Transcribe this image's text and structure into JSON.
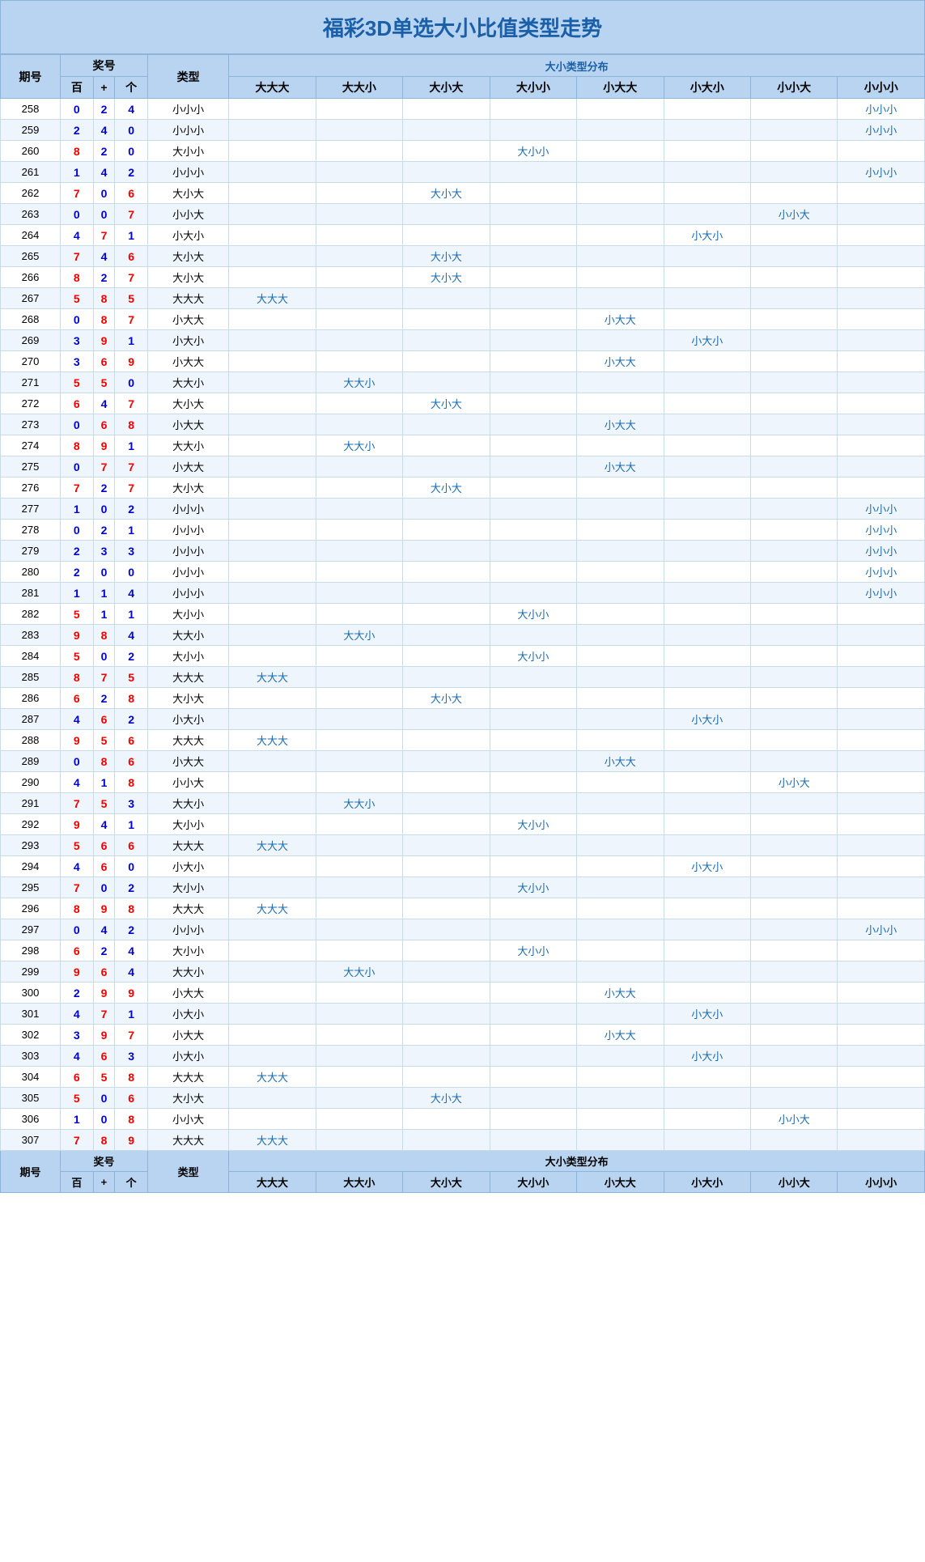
{
  "title": "福彩3D单选大小比值类型走势",
  "headers": {
    "period": "期号",
    "prize_label": "奖号",
    "hundred": "百",
    "ten": "+",
    "unit": "个",
    "type": "类型",
    "dist_label": "大小类型分布",
    "cols": [
      "大大大",
      "大大小",
      "大小大",
      "大小小",
      "小大大",
      "小大小",
      "小小大",
      "小小小"
    ]
  },
  "rows": [
    {
      "period": "258",
      "h": "0",
      "t": "2",
      "u": "4",
      "type": "小小小",
      "dist": [
        null,
        null,
        null,
        null,
        null,
        null,
        null,
        "小小小"
      ]
    },
    {
      "period": "259",
      "h": "2",
      "t": "4",
      "u": "0",
      "type": "小小小",
      "dist": [
        null,
        null,
        null,
        null,
        null,
        null,
        null,
        "小小小"
      ]
    },
    {
      "period": "260",
      "h": "8",
      "t": "2",
      "u": "0",
      "type": "大小小",
      "dist": [
        null,
        null,
        null,
        "大小小",
        null,
        null,
        null,
        null
      ]
    },
    {
      "period": "261",
      "h": "1",
      "t": "4",
      "u": "2",
      "type": "小小小",
      "dist": [
        null,
        null,
        null,
        null,
        null,
        null,
        null,
        "小小小"
      ]
    },
    {
      "period": "262",
      "h": "7",
      "t": "0",
      "u": "6",
      "type": "大小大",
      "dist": [
        null,
        null,
        "大小大",
        null,
        null,
        null,
        null,
        null
      ]
    },
    {
      "period": "263",
      "h": "0",
      "t": "0",
      "u": "7",
      "type": "小小大",
      "dist": [
        null,
        null,
        null,
        null,
        null,
        null,
        "小小大",
        null
      ]
    },
    {
      "period": "264",
      "h": "4",
      "t": "7",
      "u": "1",
      "type": "小大小",
      "dist": [
        null,
        null,
        null,
        null,
        null,
        "小大小",
        null,
        null
      ]
    },
    {
      "period": "265",
      "h": "7",
      "t": "4",
      "u": "6",
      "type": "大小大",
      "dist": [
        null,
        null,
        "大小大",
        null,
        null,
        null,
        null,
        null
      ]
    },
    {
      "period": "266",
      "h": "8",
      "t": "2",
      "u": "7",
      "type": "大小大",
      "dist": [
        null,
        null,
        "大小大",
        null,
        null,
        null,
        null,
        null
      ]
    },
    {
      "period": "267",
      "h": "5",
      "t": "8",
      "u": "5",
      "type": "大大大",
      "dist": [
        "大大大",
        null,
        null,
        null,
        null,
        null,
        null,
        null
      ]
    },
    {
      "period": "268",
      "h": "0",
      "t": "8",
      "u": "7",
      "type": "小大大",
      "dist": [
        null,
        null,
        null,
        null,
        "小大大",
        null,
        null,
        null
      ]
    },
    {
      "period": "269",
      "h": "3",
      "t": "9",
      "u": "1",
      "type": "小大小",
      "dist": [
        null,
        null,
        null,
        null,
        null,
        "小大小",
        null,
        null
      ]
    },
    {
      "period": "270",
      "h": "3",
      "t": "6",
      "u": "9",
      "type": "小大大",
      "dist": [
        null,
        null,
        null,
        null,
        "小大大",
        null,
        null,
        null
      ]
    },
    {
      "period": "271",
      "h": "5",
      "t": "5",
      "u": "0",
      "type": "大大小",
      "dist": [
        null,
        "大大小",
        null,
        null,
        null,
        null,
        null,
        null
      ]
    },
    {
      "period": "272",
      "h": "6",
      "t": "4",
      "u": "7",
      "type": "大小大",
      "dist": [
        null,
        null,
        "大小大",
        null,
        null,
        null,
        null,
        null
      ]
    },
    {
      "period": "273",
      "h": "0",
      "t": "6",
      "u": "8",
      "type": "小大大",
      "dist": [
        null,
        null,
        null,
        null,
        "小大大",
        null,
        null,
        null
      ]
    },
    {
      "period": "274",
      "h": "8",
      "t": "9",
      "u": "1",
      "type": "大大小",
      "dist": [
        null,
        "大大小",
        null,
        null,
        null,
        null,
        null,
        null
      ]
    },
    {
      "period": "275",
      "h": "0",
      "t": "7",
      "u": "7",
      "type": "小大大",
      "dist": [
        null,
        null,
        null,
        null,
        "小大大",
        null,
        null,
        null
      ]
    },
    {
      "period": "276",
      "h": "7",
      "t": "2",
      "u": "7",
      "type": "大小大",
      "dist": [
        null,
        null,
        "大小大",
        null,
        null,
        null,
        null,
        null
      ]
    },
    {
      "period": "277",
      "h": "1",
      "t": "0",
      "u": "2",
      "type": "小小小",
      "dist": [
        null,
        null,
        null,
        null,
        null,
        null,
        null,
        "小小小"
      ]
    },
    {
      "period": "278",
      "h": "0",
      "t": "2",
      "u": "1",
      "type": "小小小",
      "dist": [
        null,
        null,
        null,
        null,
        null,
        null,
        null,
        "小小小"
      ]
    },
    {
      "period": "279",
      "h": "2",
      "t": "3",
      "u": "3",
      "type": "小小小",
      "dist": [
        null,
        null,
        null,
        null,
        null,
        null,
        null,
        "小小小"
      ]
    },
    {
      "period": "280",
      "h": "2",
      "t": "0",
      "u": "0",
      "type": "小小小",
      "dist": [
        null,
        null,
        null,
        null,
        null,
        null,
        null,
        "小小小"
      ]
    },
    {
      "period": "281",
      "h": "1",
      "t": "1",
      "u": "4",
      "type": "小小小",
      "dist": [
        null,
        null,
        null,
        null,
        null,
        null,
        null,
        "小小小"
      ]
    },
    {
      "period": "282",
      "h": "5",
      "t": "1",
      "u": "1",
      "type": "大小小",
      "dist": [
        null,
        null,
        null,
        "大小小",
        null,
        null,
        null,
        null
      ]
    },
    {
      "period": "283",
      "h": "9",
      "t": "8",
      "u": "4",
      "type": "大大小",
      "dist": [
        null,
        "大大小",
        null,
        null,
        null,
        null,
        null,
        null
      ]
    },
    {
      "period": "284",
      "h": "5",
      "t": "0",
      "u": "2",
      "type": "大小小",
      "dist": [
        null,
        null,
        null,
        "大小小",
        null,
        null,
        null,
        null
      ]
    },
    {
      "period": "285",
      "h": "8",
      "t": "7",
      "u": "5",
      "type": "大大大",
      "dist": [
        "大大大",
        null,
        null,
        null,
        null,
        null,
        null,
        null
      ]
    },
    {
      "period": "286",
      "h": "6",
      "t": "2",
      "u": "8",
      "type": "大小大",
      "dist": [
        null,
        null,
        "大小大",
        null,
        null,
        null,
        null,
        null
      ]
    },
    {
      "period": "287",
      "h": "4",
      "t": "6",
      "u": "2",
      "type": "小大小",
      "dist": [
        null,
        null,
        null,
        null,
        null,
        "小大小",
        null,
        null
      ]
    },
    {
      "period": "288",
      "h": "9",
      "t": "5",
      "u": "6",
      "type": "大大大",
      "dist": [
        "大大大",
        null,
        null,
        null,
        null,
        null,
        null,
        null
      ]
    },
    {
      "period": "289",
      "h": "0",
      "t": "8",
      "u": "6",
      "type": "小大大",
      "dist": [
        null,
        null,
        null,
        null,
        "小大大",
        null,
        null,
        null
      ]
    },
    {
      "period": "290",
      "h": "4",
      "t": "1",
      "u": "8",
      "type": "小小大",
      "dist": [
        null,
        null,
        null,
        null,
        null,
        null,
        "小小大",
        null
      ]
    },
    {
      "period": "291",
      "h": "7",
      "t": "5",
      "u": "3",
      "type": "大大小",
      "dist": [
        null,
        "大大小",
        null,
        null,
        null,
        null,
        null,
        null
      ]
    },
    {
      "period": "292",
      "h": "9",
      "t": "4",
      "u": "1",
      "type": "大小小",
      "dist": [
        null,
        null,
        null,
        "大小小",
        null,
        null,
        null,
        null
      ]
    },
    {
      "period": "293",
      "h": "5",
      "t": "6",
      "u": "6",
      "type": "大大大",
      "dist": [
        "大大大",
        null,
        null,
        null,
        null,
        null,
        null,
        null
      ]
    },
    {
      "period": "294",
      "h": "4",
      "t": "6",
      "u": "0",
      "type": "小大小",
      "dist": [
        null,
        null,
        null,
        null,
        null,
        "小大小",
        null,
        null
      ]
    },
    {
      "period": "295",
      "h": "7",
      "t": "0",
      "u": "2",
      "type": "大小小",
      "dist": [
        null,
        null,
        null,
        "大小小",
        null,
        null,
        null,
        null
      ]
    },
    {
      "period": "296",
      "h": "8",
      "t": "9",
      "u": "8",
      "type": "大大大",
      "dist": [
        "大大大",
        null,
        null,
        null,
        null,
        null,
        null,
        null
      ]
    },
    {
      "period": "297",
      "h": "0",
      "t": "4",
      "u": "2",
      "type": "小小小",
      "dist": [
        null,
        null,
        null,
        null,
        null,
        null,
        null,
        "小小小"
      ]
    },
    {
      "period": "298",
      "h": "6",
      "t": "2",
      "u": "4",
      "type": "大小小",
      "dist": [
        null,
        null,
        null,
        "大小小",
        null,
        null,
        null,
        null
      ]
    },
    {
      "period": "299",
      "h": "9",
      "t": "6",
      "u": "4",
      "type": "大大小",
      "dist": [
        null,
        "大大小",
        null,
        null,
        null,
        null,
        null,
        null
      ]
    },
    {
      "period": "300",
      "h": "2",
      "t": "9",
      "u": "9",
      "type": "小大大",
      "dist": [
        null,
        null,
        null,
        null,
        "小大大",
        null,
        null,
        null
      ]
    },
    {
      "period": "301",
      "h": "4",
      "t": "7",
      "u": "1",
      "type": "小大小",
      "dist": [
        null,
        null,
        null,
        null,
        null,
        "小大小",
        null,
        null
      ]
    },
    {
      "period": "302",
      "h": "3",
      "t": "9",
      "u": "7",
      "type": "小大大",
      "dist": [
        null,
        null,
        null,
        null,
        "小大大",
        null,
        null,
        null
      ]
    },
    {
      "period": "303",
      "h": "4",
      "t": "6",
      "u": "3",
      "type": "小大小",
      "dist": [
        null,
        null,
        null,
        null,
        null,
        "小大小",
        null,
        null
      ]
    },
    {
      "period": "304",
      "h": "6",
      "t": "5",
      "u": "8",
      "type": "大大大",
      "dist": [
        "大大大",
        null,
        null,
        null,
        null,
        null,
        null,
        null
      ]
    },
    {
      "period": "305",
      "h": "5",
      "t": "0",
      "u": "6",
      "type": "大小大",
      "dist": [
        null,
        null,
        "大小大",
        null,
        null,
        null,
        null,
        null
      ]
    },
    {
      "period": "306",
      "h": "1",
      "t": "0",
      "u": "8",
      "type": "小小大",
      "dist": [
        null,
        null,
        null,
        null,
        null,
        null,
        "小小大",
        null
      ]
    },
    {
      "period": "307",
      "h": "7",
      "t": "8",
      "u": "9",
      "type": "大大大",
      "dist": [
        "大大大",
        null,
        null,
        null,
        null,
        null,
        null,
        null
      ]
    }
  ],
  "footer": {
    "period": "期号",
    "prize": "奖号",
    "hundred": "百",
    "ten": "+",
    "unit": "个",
    "type": "类型",
    "dist": "大小类型分布",
    "cols": [
      "大大大",
      "大大小",
      "大小大",
      "大小小",
      "小大大",
      "小大小",
      "小小大",
      "小小小"
    ]
  }
}
